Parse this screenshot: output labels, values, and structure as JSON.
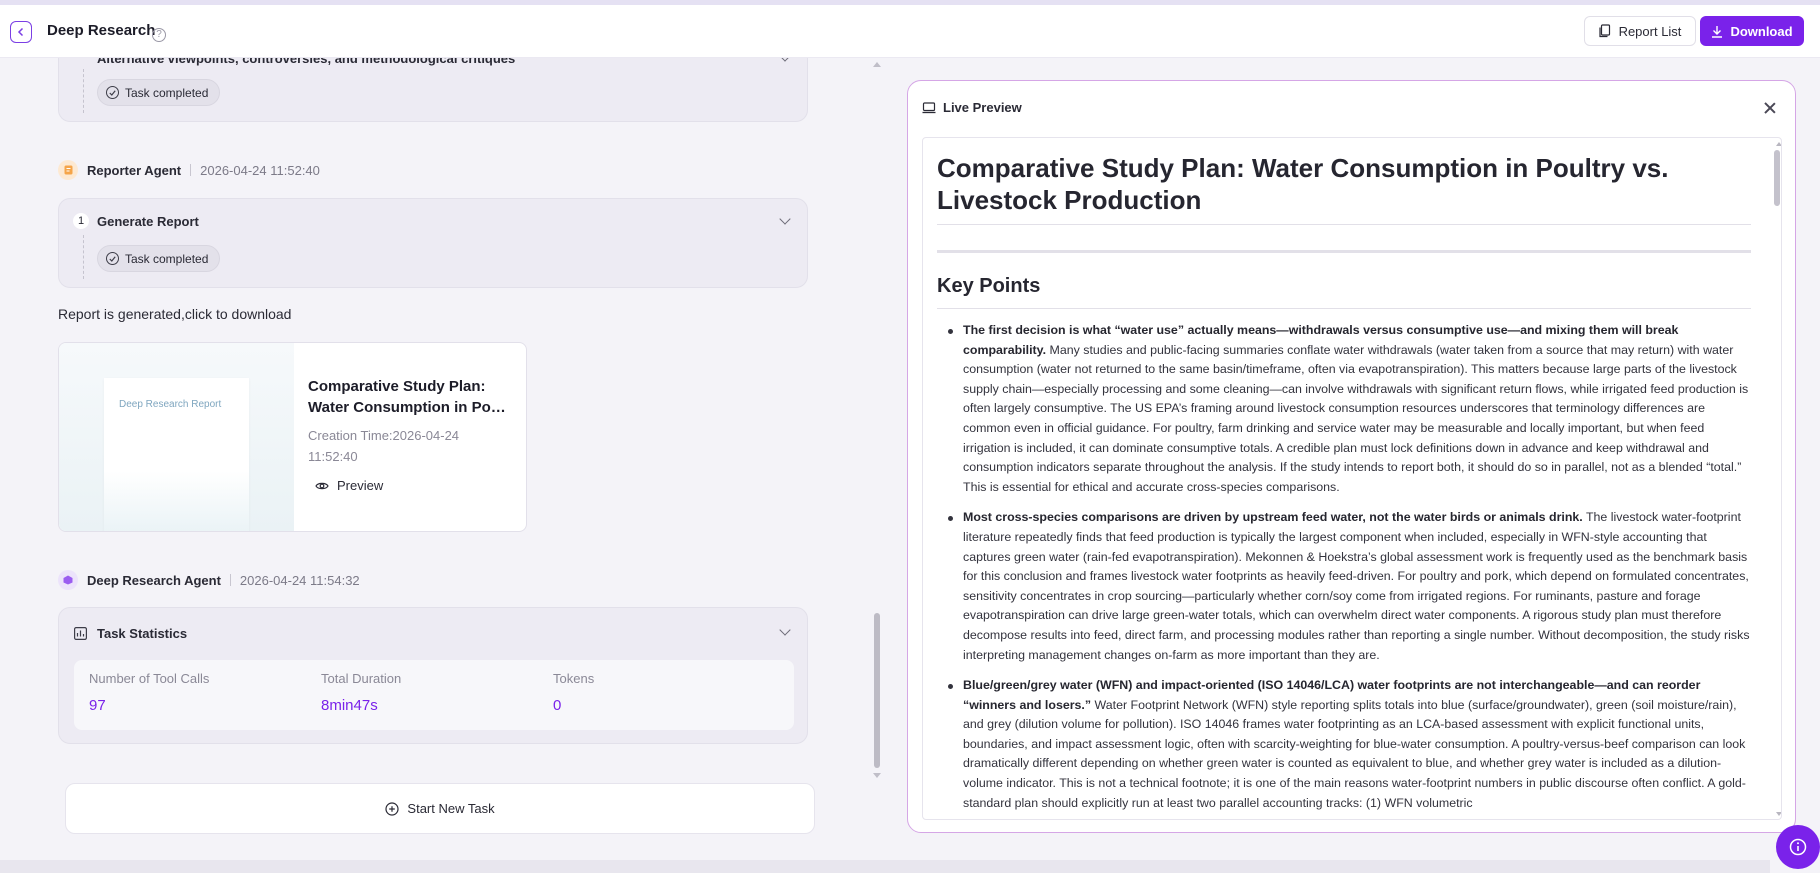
{
  "header": {
    "title": "Deep Research",
    "report_list_label": "Report List",
    "download_label": "Download"
  },
  "task_cards": [
    {
      "title": "Alternative viewpoints, controversies, and methodological critiques",
      "status": "Task completed"
    },
    {
      "index": "1",
      "title": "Generate Report",
      "status": "Task completed"
    }
  ],
  "agents": {
    "reporter": {
      "name": "Reporter Agent",
      "time": "2026-04-24 11:52:40"
    },
    "deep_research": {
      "name": "Deep Research Agent",
      "time": "2026-04-24 11:54:32"
    }
  },
  "report": {
    "generated_text": "Report is generated,click to download",
    "thumbnail_label": "Deep Research Report",
    "title_line1": "Comparative Study Plan:",
    "title_line2": "Water Consumption in Poult...",
    "creation_time_line1": "Creation Time:2026-04-24",
    "creation_time_line2": "11:52:40",
    "preview_label": "Preview"
  },
  "stats": {
    "title": "Task Statistics",
    "items": [
      {
        "label": "Number of Tool Calls",
        "value": "97"
      },
      {
        "label": "Total Duration",
        "value": "8min47s"
      },
      {
        "label": "Tokens",
        "value": "0"
      }
    ]
  },
  "start_new_task_label": "Start New Task",
  "live_preview": {
    "title": "Live Preview",
    "doc_title": "Comparative Study Plan: Water Consumption in Poultry vs. Livestock Production",
    "section_title": "Key Points",
    "items": [
      {
        "bold": "The first decision is what “water use” actually means—withdrawals versus consumptive use—and mixing them will break comparability.",
        "text": " Many studies and public-facing summaries conflate water withdrawals (water taken from a source that may return) with water consumption (water not returned to the same basin/timeframe, often via evapotranspiration). This matters because large parts of the livestock supply chain—especially processing and some cleaning—can involve withdrawals with significant return flows, while irrigated feed production is often largely consumptive. The US EPA’s framing around livestock consumption resources underscores that terminology differences are common even in official guidance. For poultry, farm drinking and service water may be measurable and locally important, but when feed irrigation is included, it can dominate consumptive totals. A credible plan must lock definitions down in advance and keep withdrawal and consumption indicators separate throughout the analysis. If the study intends to report both, it should do so in parallel, not as a blended “total.” This is essential for ethical and accurate cross-species comparisons."
      },
      {
        "bold": "Most cross-species comparisons are driven by upstream feed water, not the water birds or animals drink.",
        "text": " The livestock water-footprint literature repeatedly finds that feed production is typically the largest component when included, especially in WFN-style accounting that captures green water (rain-fed evapotranspiration). Mekonnen & Hoekstra’s global assessment work is frequently used as the benchmark basis for this conclusion and frames livestock water footprints as heavily feed-driven. For poultry and pork, which depend on formulated concentrates, sensitivity concentrates in crop sourcing—particularly whether corn/soy come from irrigated regions. For ruminants, pasture and forage evapotranspiration can drive large green-water totals, which can overwhelm direct water components. A rigorous study plan must therefore decompose results into feed, direct farm, and processing modules rather than reporting a single number. Without decomposition, the study risks interpreting management changes on-farm as more important than they are."
      },
      {
        "bold": "Blue/green/grey water (WFN) and impact-oriented (ISO 14046/LCA) water footprints are not interchangeable—and can reorder “winners and losers.”",
        "text": " Water Footprint Network (WFN) style reporting splits totals into blue (surface/groundwater), green (soil moisture/rain), and grey (dilution volume for pollution). ISO 14046 frames water footprinting as an LCA-based assessment with explicit functional units, boundaries, and impact assessment logic, often with scarcity-weighting for blue-water consumption. A poultry-versus-beef comparison can look dramatically different depending on whether green water is counted as equivalent to blue, and whether grey water is included as a dilution-volume indicator. This is not a technical footnote; it is one of the main reasons water-footprint numbers in public discourse often conflict. A gold-standard plan should explicitly run at least two parallel accounting tracks: (1) WFN volumetric"
      }
    ]
  },
  "colors": {
    "accent": "#7a22ea",
    "stat_value": "#7a22ea",
    "preview_border": "#d5a6e6"
  }
}
